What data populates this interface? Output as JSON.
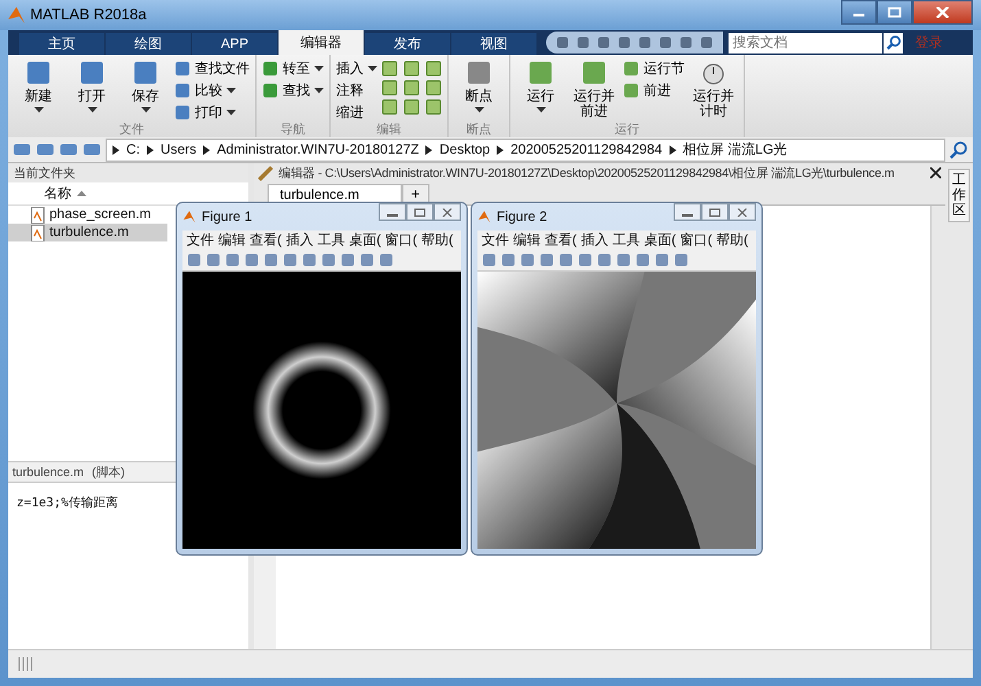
{
  "window": {
    "title": "MATLAB R2018a"
  },
  "tabs": [
    {
      "label": "主页",
      "selected": false
    },
    {
      "label": "绘图",
      "selected": false
    },
    {
      "label": "APP",
      "selected": false
    },
    {
      "label": "编辑器",
      "selected": true
    },
    {
      "label": "发布",
      "selected": false
    },
    {
      "label": "视图",
      "selected": false
    }
  ],
  "search": {
    "placeholder": "搜索文档"
  },
  "login": "登录",
  "ribbon": {
    "groups": [
      {
        "label": "文件",
        "large": [
          {
            "label": "新建",
            "dropdown": true
          },
          {
            "label": "打开",
            "dropdown": true
          },
          {
            "label": "保存",
            "dropdown": true
          }
        ],
        "small": [
          {
            "label": "查找文件",
            "dropdown": false
          },
          {
            "label": "比较",
            "dropdown": true
          },
          {
            "label": "打印",
            "dropdown": true
          }
        ]
      },
      {
        "label": "导航",
        "small": [
          {
            "label": "转至",
            "dropdown": true
          },
          {
            "label": "查找",
            "dropdown": true
          }
        ]
      },
      {
        "label": "编辑",
        "small": [
          {
            "label": "插入",
            "dropdown": true
          },
          {
            "label": "注释",
            "dropdown": false
          },
          {
            "label": "缩进",
            "dropdown": false
          }
        ]
      },
      {
        "label": "断点",
        "large": [
          {
            "label": "断点",
            "dropdown": true
          }
        ]
      },
      {
        "label": "运行",
        "large": [
          {
            "label": "运行",
            "dropdown": true
          },
          {
            "label": "运行并前进",
            "dropdown": false
          }
        ],
        "small": [
          {
            "label": "运行节",
            "dropdown": false
          },
          {
            "label": "前进",
            "dropdown": false
          }
        ],
        "tail": [
          {
            "label": "运行并计时"
          }
        ]
      }
    ]
  },
  "address": [
    "C:",
    "Users",
    "Administrator.WIN7U-20180127Z",
    "Desktop",
    "20200525201129842984",
    "相位屏 湍流LG光"
  ],
  "current_folder": {
    "title": "当前文件夹",
    "column": "名称",
    "files": [
      {
        "name": "phase_screen.m",
        "selected": false
      },
      {
        "name": "turbulence.m",
        "selected": true
      }
    ],
    "details_title": "turbulence.m",
    "details_type": "(脚本)",
    "details_code": "z=1e3;%传输距离"
  },
  "editor": {
    "title": "编辑器 - C:\\Users\\Administrator.WIN7U-20180127Z\\Desktop\\20200525201129842984\\相位屏 湍流LG光\\turbulence.m",
    "tabs": [
      {
        "label": "turbulence.m",
        "selected": true
      }
    ],
    "add": "+"
  },
  "side_tab": "工作区",
  "figures": [
    {
      "title": "Figure 1",
      "kind": "ring",
      "menu": [
        "文件",
        "编辑",
        "查看(",
        "插入",
        "工具",
        "桌面(",
        "窗口(",
        "帮助("
      ]
    },
    {
      "title": "Figure 2",
      "kind": "phase",
      "menu": [
        "文件",
        "编辑",
        "查看(",
        "插入",
        "工具",
        "桌面(",
        "窗口(",
        "帮助("
      ]
    }
  ]
}
